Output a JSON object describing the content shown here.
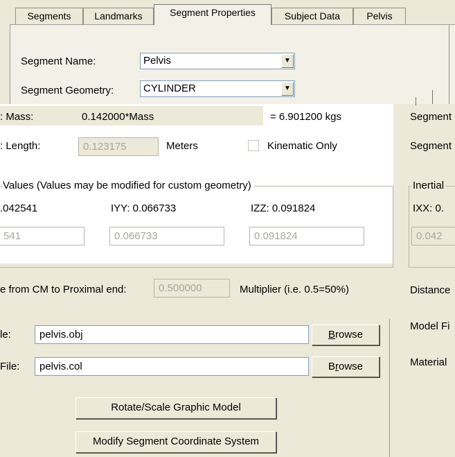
{
  "tabs": [
    {
      "label": "Segments",
      "active": false
    },
    {
      "label": "Landmarks",
      "active": false
    },
    {
      "label": "Segment Properties",
      "active": true
    },
    {
      "label": "Subject Data",
      "active": false
    },
    {
      "label": "Pelvis",
      "active": false
    }
  ],
  "segment_name": {
    "label": "Segment Name:",
    "value": "Pelvis"
  },
  "segment_geometry": {
    "label": "Segment Geometry:",
    "value": "CYLINDER"
  },
  "mass": {
    "label": ": Mass:",
    "formula": "0.142000*Mass",
    "result": "=  6.901200  kgs"
  },
  "length": {
    "label": ": Length:",
    "value": "0.123175",
    "unit": "Meters",
    "kinematic_label": "Kinematic Only",
    "kinematic_checked": false
  },
  "inertial": {
    "group_label": "Values (Values may be modified for custom geometry)",
    "ixx_label": ".042541",
    "iyy_label": "IYY: 0.066733",
    "izz_label": "IZZ: 0.091824",
    "ixx_value": "541",
    "iyy_value": "0.066733",
    "izz_value": "0.091824"
  },
  "proximal": {
    "label": "e from CM to Proximal end:",
    "value": "0.500000",
    "suffix": "Multiplier (i.e. 0.5=50%)"
  },
  "model_file": {
    "label": "le:",
    "value": "pelvis.obj",
    "browse": "Browse"
  },
  "collision_file": {
    "label": "File:",
    "value": "pelvis.col",
    "browse": "Browse"
  },
  "buttons": {
    "rotate": "Rotate/Scale Graphic Model",
    "modify": "Modify Segment Coordinate System"
  },
  "right_column": {
    "segment1": "Segment",
    "segment2": "Segment",
    "inertial": "Inertial",
    "ixx": "IXX: 0.",
    "ixx_value": "0.042",
    "distance": "Distance",
    "model_file": "Model Fi",
    "material": "Material"
  }
}
